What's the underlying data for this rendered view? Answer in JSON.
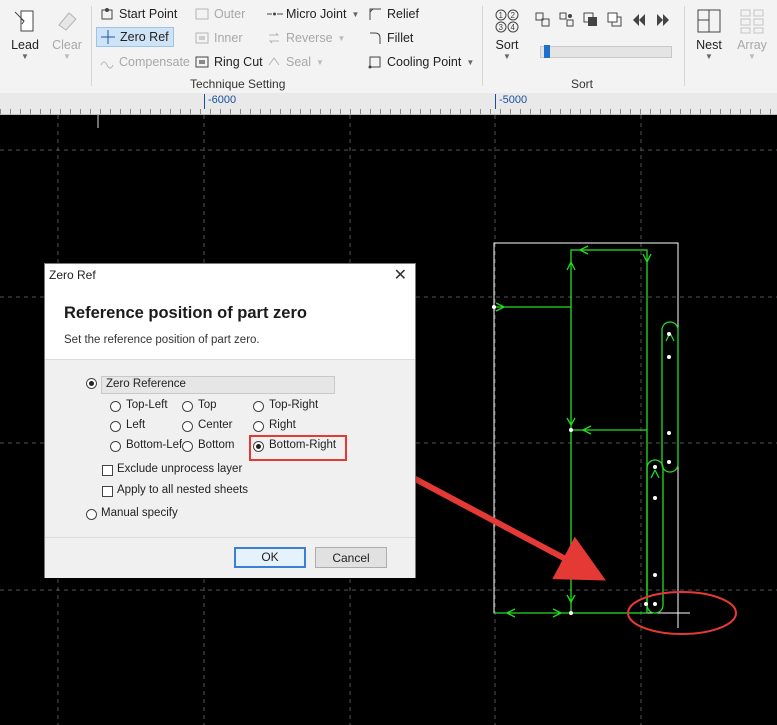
{
  "ribbon": {
    "lead": "Lead",
    "clear": "Clear",
    "start_point": "Start Point",
    "zero_ref": "Zero Ref",
    "compensate": "Compensate",
    "outer": "Outer",
    "inner": "Inner",
    "ring_cut": "Ring Cut",
    "micro_joint": "Micro Joint",
    "reverse": "Reverse",
    "seal": "Seal",
    "relief": "Relief",
    "fillet": "Fillet",
    "cooling_point": "Cooling Point",
    "technique_group": "Technique Setting",
    "sort": "Sort",
    "sort_group": "Sort",
    "nest": "Nest",
    "array": "Array"
  },
  "ruler": {
    "labels": [
      "-6000",
      "-5000"
    ]
  },
  "dialog": {
    "title": "Zero Ref",
    "heading": "Reference position of part zero",
    "description": "Set the reference position of part zero.",
    "zero_reference": "Zero Reference",
    "options": {
      "top_left": "Top-Left",
      "top": "Top",
      "top_right": "Top-Right",
      "left": "Left",
      "center": "Center",
      "right": "Right",
      "bottom_left": "Bottom-Lef",
      "bottom": "Bottom",
      "bottom_right": "Bottom-Right"
    },
    "selected_option": "Bottom-Right",
    "exclude_unprocess": "Exclude unprocess layer",
    "apply_nested": "Apply to all nested sheets",
    "manual_specify": "Manual specify",
    "ok": "OK",
    "cancel": "Cancel"
  },
  "colors": {
    "part_geometry": "#22dd22",
    "sheet_outline": "#ffffff",
    "annotation": "#e53935",
    "canvas_bg": "#000000"
  }
}
